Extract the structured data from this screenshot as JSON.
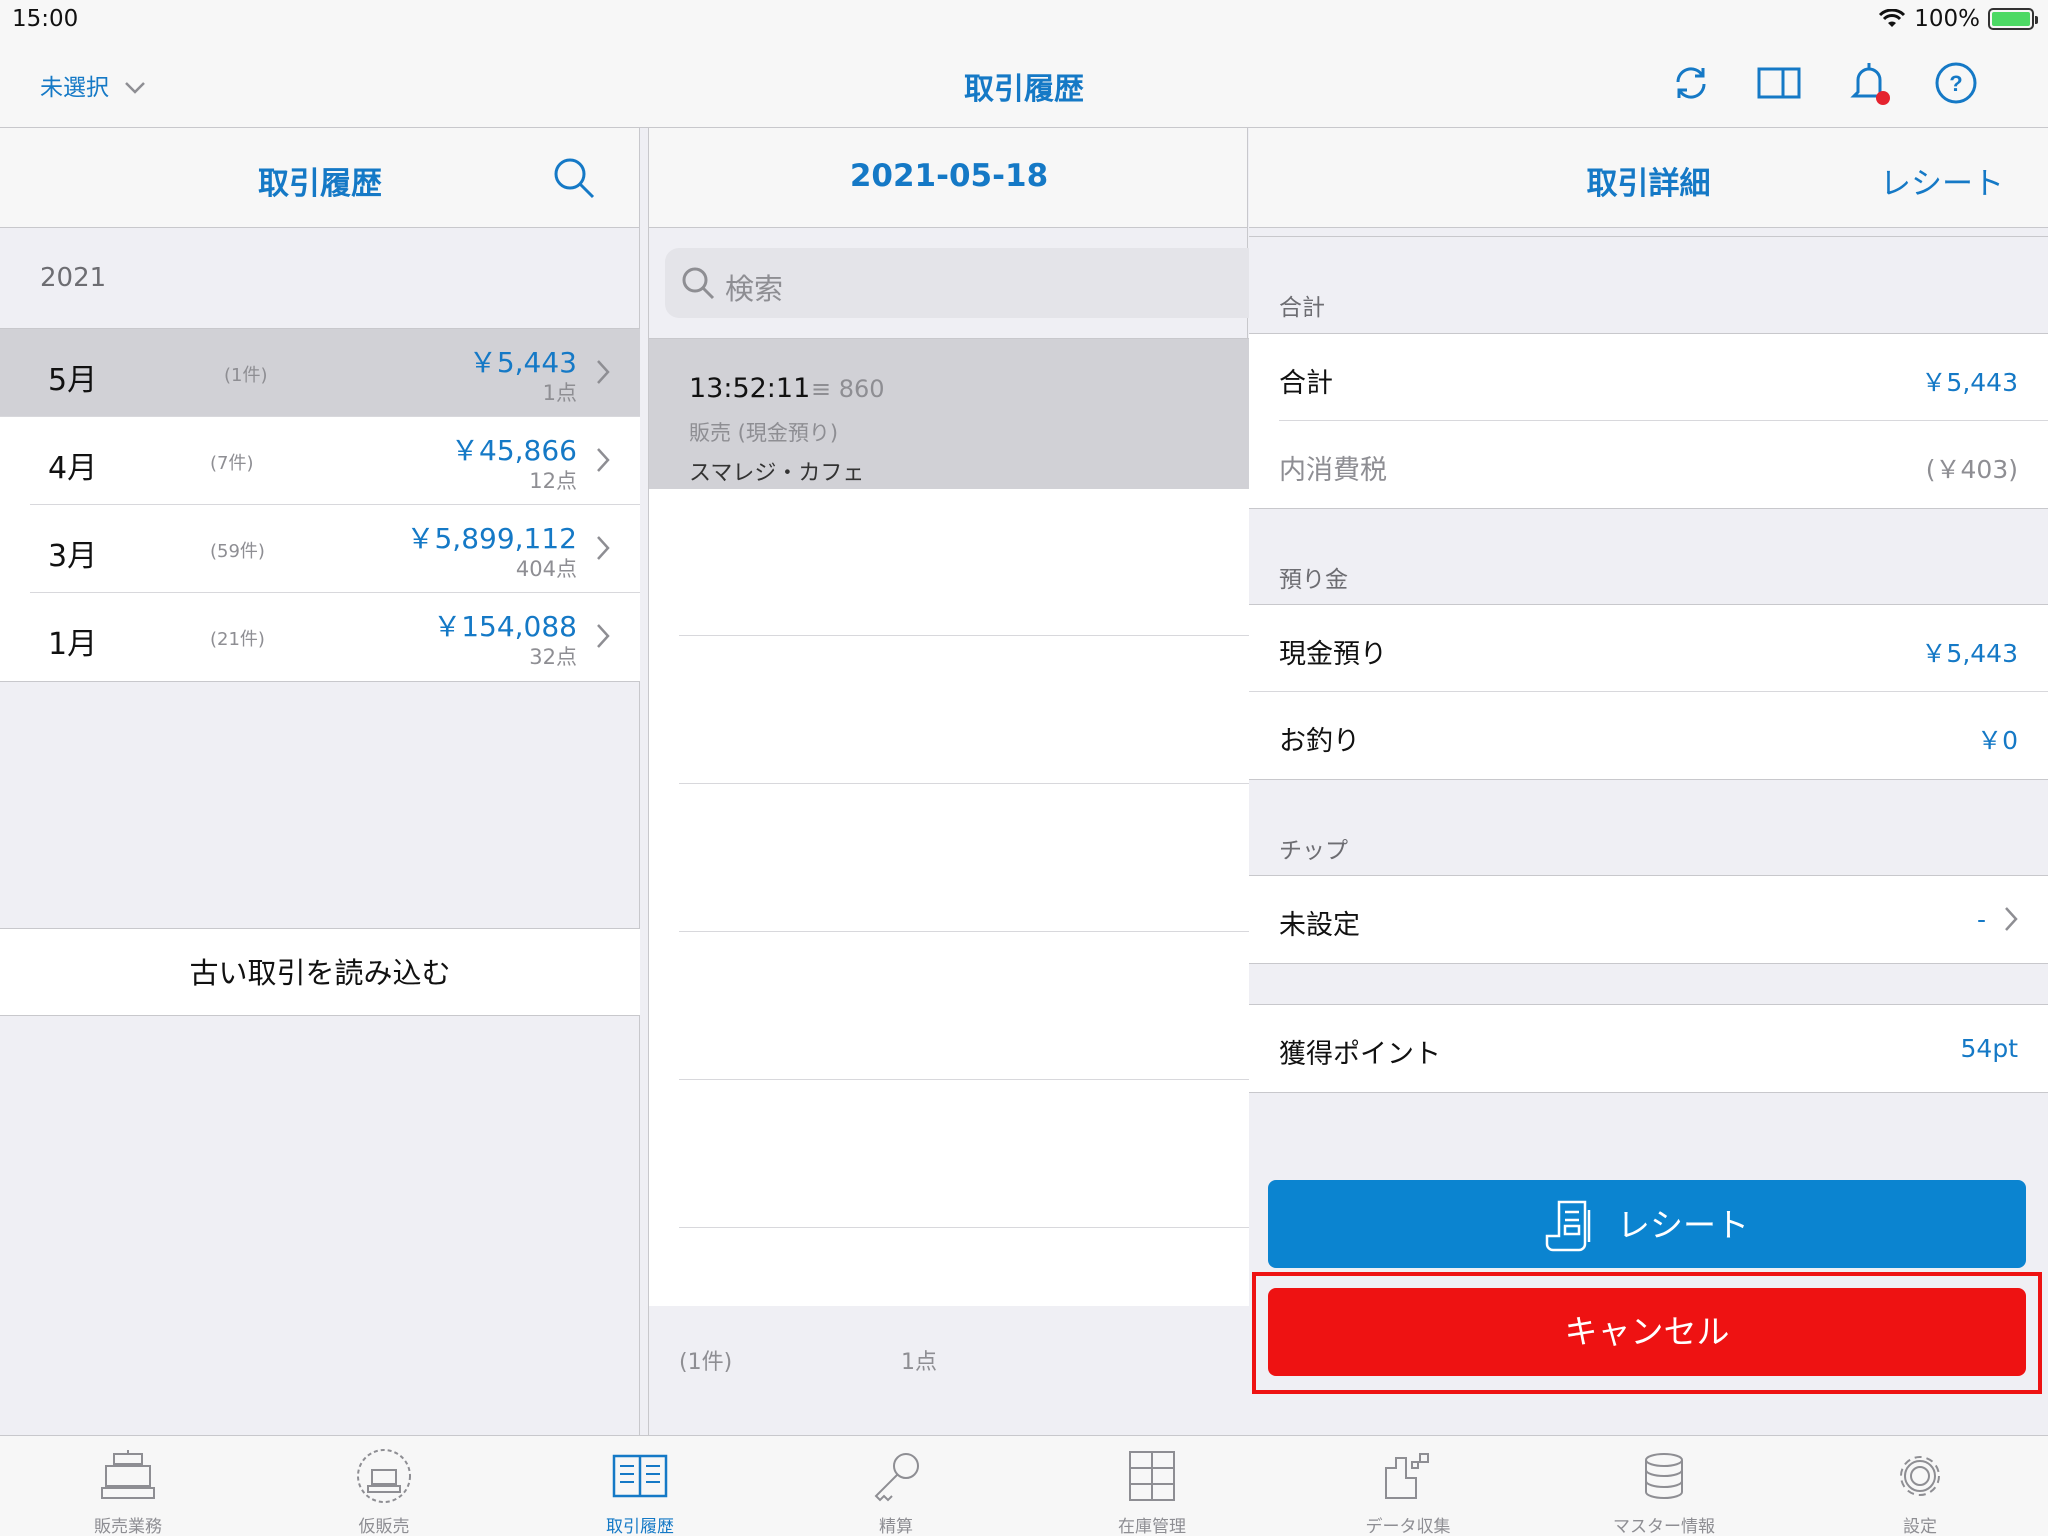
{
  "status": {
    "time": "15:00",
    "battery": "100%"
  },
  "nav": {
    "store_selector": "未選択",
    "title": "取引履歴"
  },
  "col1": {
    "title": "取引履歴",
    "year": "2021",
    "months": [
      {
        "label": "5月",
        "count": "(1件)",
        "amount": "￥5,443",
        "points": "1点",
        "selected": true
      },
      {
        "label": "4月",
        "count": "(7件)",
        "amount": "￥45,866",
        "points": "12点",
        "selected": false
      },
      {
        "label": "3月",
        "count": "(59件)",
        "amount": "￥5,899,112",
        "points": "404点",
        "selected": false
      },
      {
        "label": "1月",
        "count": "(21件)",
        "amount": "￥154,088",
        "points": "32点",
        "selected": false
      }
    ],
    "load_older": "古い取引を読み込む"
  },
  "col2": {
    "date": "2021-05-18",
    "search_placeholder": "検索",
    "transaction": {
      "time": "13:52:11",
      "id": "≡ 860",
      "kind": "販売 (現金預り)",
      "store": "スマレジ・カフェ"
    },
    "footer": {
      "count": "(1件)",
      "points": "1点"
    }
  },
  "col3": {
    "title": "取引詳細",
    "receipt_link": "レシート",
    "total_section": "合計",
    "total_label": "合計",
    "total_value": "￥5,443",
    "tax_label": "内消費税",
    "tax_value": "(￥403)",
    "deposit_section": "預り金",
    "cash_label": "現金預り",
    "cash_value": "￥5,443",
    "change_label": "お釣り",
    "change_value": "￥0",
    "tip_section": "チップ",
    "tip_label": "未設定",
    "tip_value": "-",
    "points_label": "獲得ポイント",
    "points_value": "54pt",
    "receipt_button": "レシート",
    "cancel_button": "キャンセル"
  },
  "tabs": [
    {
      "label": "販売業務",
      "icon": "register-icon",
      "active": false
    },
    {
      "label": "仮販売",
      "icon": "temp-sale-icon",
      "active": false
    },
    {
      "label": "取引履歴",
      "icon": "history-book-icon",
      "active": true
    },
    {
      "label": "精算",
      "icon": "key-icon",
      "active": false
    },
    {
      "label": "在庫管理",
      "icon": "inventory-cabinet-icon",
      "active": false
    },
    {
      "label": "データ収集",
      "icon": "data-collect-icon",
      "active": false
    },
    {
      "label": "マスター情報",
      "icon": "database-icon",
      "active": false
    },
    {
      "label": "設定",
      "icon": "gear-icon",
      "active": false
    }
  ],
  "colors": {
    "accent": "#1579c6",
    "button_blue": "#0b84d0",
    "cancel_red": "#ee1212",
    "selected_row": "#d1d1d6"
  }
}
